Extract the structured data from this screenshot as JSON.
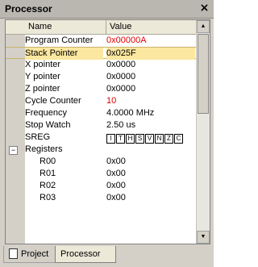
{
  "window": {
    "title": "Processor",
    "close_glyph": "×"
  },
  "columns": {
    "name": "Name",
    "value": "Value"
  },
  "rows": [
    {
      "name": "Program Counter",
      "value": "0x00000A",
      "value_color": "red"
    },
    {
      "name": "Stack Pointer",
      "value": "0x025F",
      "selected": true
    },
    {
      "name": "X pointer",
      "value": "0x0000"
    },
    {
      "name": "Y pointer",
      "value": "0x0000"
    },
    {
      "name": "Z pointer",
      "value": "0x0000"
    },
    {
      "name": "Cycle Counter",
      "value": "10",
      "value_color": "red"
    },
    {
      "name": "Frequency",
      "value": "4.0000 MHz"
    },
    {
      "name": "Stop Watch",
      "value": "2.50 us"
    }
  ],
  "sreg": {
    "name": "SREG",
    "bits": [
      "I",
      "T",
      "H",
      "S",
      "V",
      "N",
      "Z",
      "C"
    ]
  },
  "registers": {
    "label": "Registers",
    "expander_glyph": "−",
    "items": [
      {
        "name": "R00",
        "value": "0x00"
      },
      {
        "name": "R01",
        "value": "0x00"
      },
      {
        "name": "R02",
        "value": "0x00"
      },
      {
        "name": "R03",
        "value": "0x00"
      }
    ]
  },
  "tabs": [
    {
      "label": "Project",
      "icon": "document-icon"
    },
    {
      "label": "Processor",
      "active": true
    }
  ],
  "colors": {
    "selected_row": "#fbe7a0",
    "highlight_value": "#e00000"
  },
  "scrollbar": {
    "up_glyph": "▲",
    "down_glyph": "▼"
  }
}
